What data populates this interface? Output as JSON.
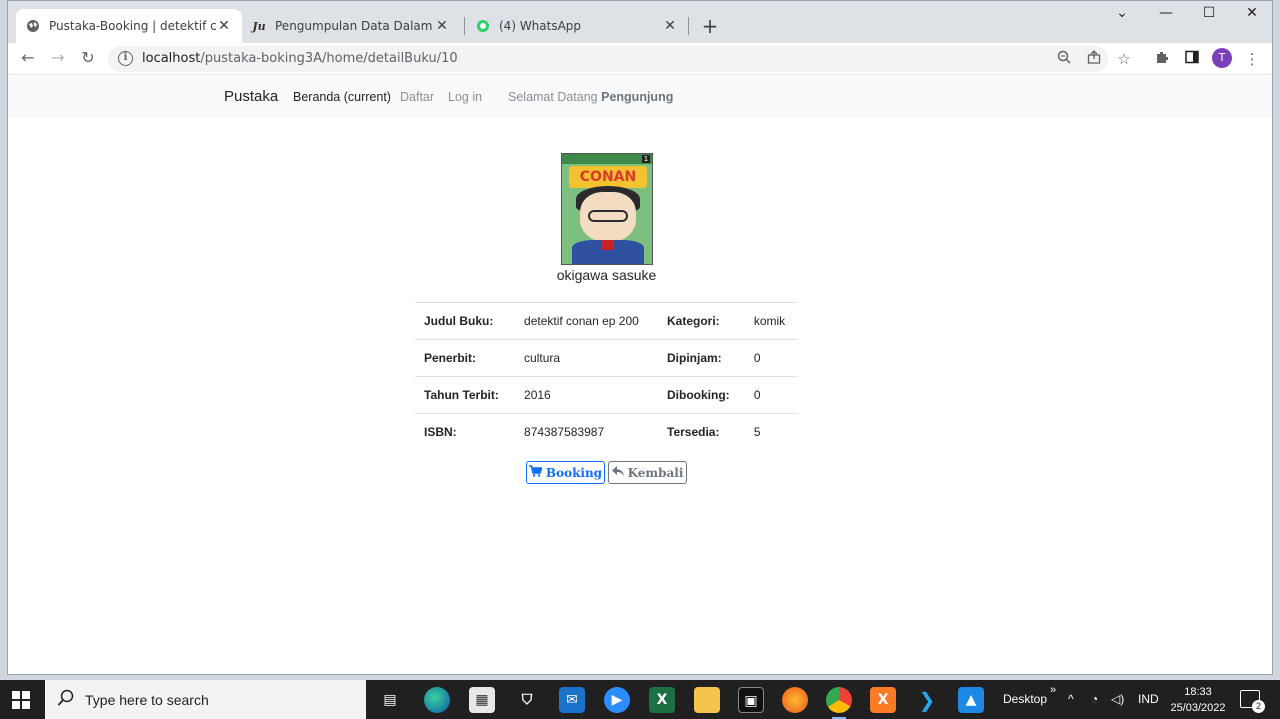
{
  "browser": {
    "tabs": [
      {
        "title": "Pustaka-Booking | detektif conan",
        "favicon": "globe-icon",
        "active": true
      },
      {
        "title": "Pengumpulan Data Dalam Peneli",
        "favicon": "jurnal-icon",
        "active": false
      },
      {
        "title": "(4) WhatsApp",
        "favicon": "whatsapp-icon",
        "active": false
      }
    ],
    "close_glyph": "✕",
    "new_tab_glyph": "+",
    "url_host": "localhost",
    "url_path": "/pustaka-boking3A/home/detailBuku/10",
    "profile_initial": "T"
  },
  "navbar": {
    "brand": "Pustaka",
    "links": [
      "Beranda (current)",
      "Daftar",
      "Log in"
    ],
    "welcome_prefix": "Selamat Datang",
    "welcome_user": "Pengunjung"
  },
  "book": {
    "cover_logo": "CONAN",
    "cover_number": "1",
    "author": "okigawa sasuke",
    "rows": [
      {
        "label1": "Judul Buku:",
        "value1": "detektif conan ep 200",
        "label2": "Kategori:",
        "value2": "komik"
      },
      {
        "label1": "Penerbit:",
        "value1": "cultura",
        "label2": "Dipinjam:",
        "value2": "0"
      },
      {
        "label1": "Tahun Terbit:",
        "value1": "2016",
        "label2": "Dibooking:",
        "value2": "0"
      },
      {
        "label1": "ISBN:",
        "value1": "874387583987",
        "label2": "Tersedia:",
        "value2": "5"
      }
    ]
  },
  "actions": {
    "booking_label": "Booking",
    "kembali_label": "Kembali"
  },
  "taskbar": {
    "search_placeholder": "Type here to search",
    "desktop_label": "Desktop",
    "language": "IND",
    "time": "18:33",
    "date": "25/03/2022",
    "notification_count": "2"
  }
}
